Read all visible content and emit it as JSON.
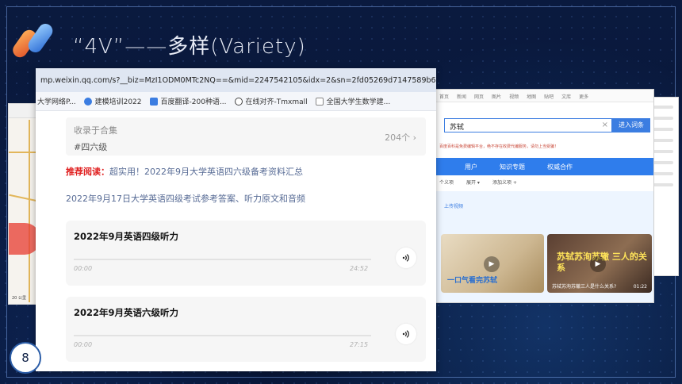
{
  "slide": {
    "title": "“4V”——多样(Variety)",
    "page_number": "8"
  },
  "wechat": {
    "url": "mp.weixin.qq.com/s?__biz=MzI1ODM0MTc2NQ==&mid=2247542105&idx=2&sn=2fd05269d7147589b674593a2addc3d2&chks...",
    "bookmarks": [
      {
        "label": "大学网络P...",
        "icon": "bookmark-icon",
        "color": "#f0c040"
      },
      {
        "label": "建模培训2022",
        "icon": "bookmark-icon",
        "color": "#3b7de1"
      },
      {
        "label": "百度翻译-200种语...",
        "icon": "translate-icon",
        "color": "#3b7de1"
      },
      {
        "label": "在线对齐-Tmxmall",
        "icon": "align-icon",
        "color": "#444444"
      },
      {
        "label": "全国大学生数学建...",
        "icon": "doc-icon",
        "color": "#888888"
      }
    ],
    "collection": {
      "label": "收录于合集",
      "tag": "#四六级",
      "count": "204个 ›"
    },
    "recommend": {
      "prefix": "推荐阅读：",
      "text": "超实用！2022年9月大学英语四六级备考资料汇总"
    },
    "article_link": "2022年9月17日大学英语四级考试参考答案、听力原文和音频",
    "audios": [
      {
        "title": "2022年9月英语四级听力",
        "start": "00:00",
        "duration": "24:52"
      },
      {
        "title": "2022年9月英语六级听力",
        "start": "00:00",
        "duration": "27:15"
      }
    ]
  },
  "baike": {
    "topbar": [
      "首页",
      "新闻",
      "网页",
      "图片",
      "视频",
      "地图",
      "贴吧",
      "文库",
      "更多"
    ],
    "search_value": "苏轼",
    "enter_label": "进入词条",
    "notice": "百度百科是免费编辑平台，绝不存在收费代编服务，请勿上当受骗！",
    "nav": [
      "用户",
      "知识专题",
      "权威合作"
    ],
    "subnav": [
      "个义项",
      "展开 ▾",
      "添加义项 +"
    ],
    "upload_label": "上传视频",
    "video1_caption": "一口气看完苏轼",
    "video2_title": "苏轼苏洵苏辙 三人的关系",
    "video2_meta": "苏轼苏洵苏辙三人是什么关系?",
    "video2_duration": "01:22"
  },
  "map": {
    "scale": "20 公里"
  }
}
